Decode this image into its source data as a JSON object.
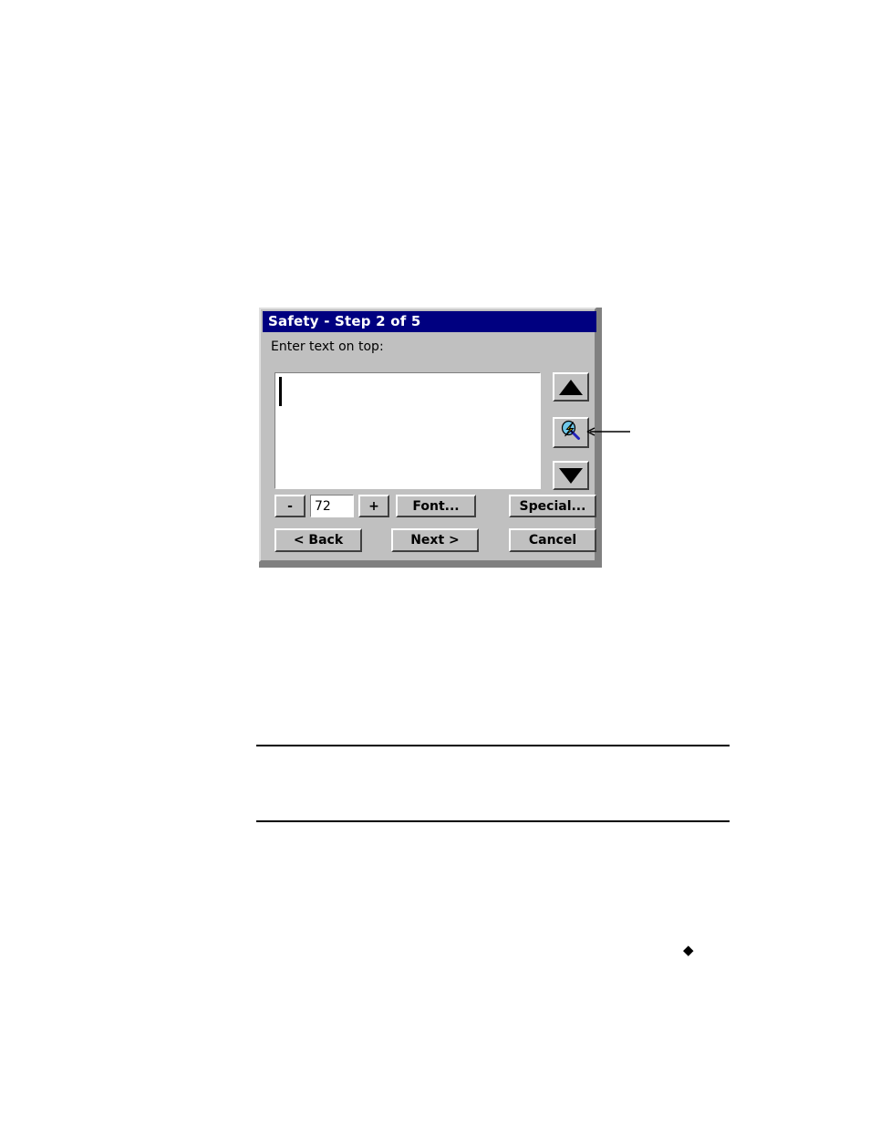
{
  "document": {
    "background_color": "#ffffff",
    "rules": [
      {
        "name": "upper-rule"
      },
      {
        "name": "lower-rule"
      }
    ],
    "bullet_marker": "◆"
  },
  "dialog": {
    "title": "Safety - Step 2 of 5",
    "title_bar_color": "#000080",
    "title_text_color": "#ffffff",
    "face_color": "#c0c0c0",
    "prompt_label": "Enter text on top:",
    "text_area": {
      "value": "",
      "placeholder": "",
      "caret_visible": true,
      "background_color": "#ffffff"
    },
    "side_buttons": [
      {
        "name": "scroll-up",
        "icon": "triangle-up-icon",
        "label": ""
      },
      {
        "name": "special-effect",
        "icon": "lightning-bolt-icon",
        "label": ""
      },
      {
        "name": "scroll-down",
        "icon": "triangle-down-icon",
        "label": ""
      }
    ],
    "size_spinner": {
      "decrement_label": "-",
      "value": "72",
      "increment_label": "+"
    },
    "buttons": {
      "font": "Font...",
      "special": "Special...",
      "back": "< Back",
      "next": "Next >",
      "cancel": "Cancel"
    }
  },
  "annotation": {
    "callout_arrow": "leader-line pointing left to the lightning-bolt button"
  }
}
